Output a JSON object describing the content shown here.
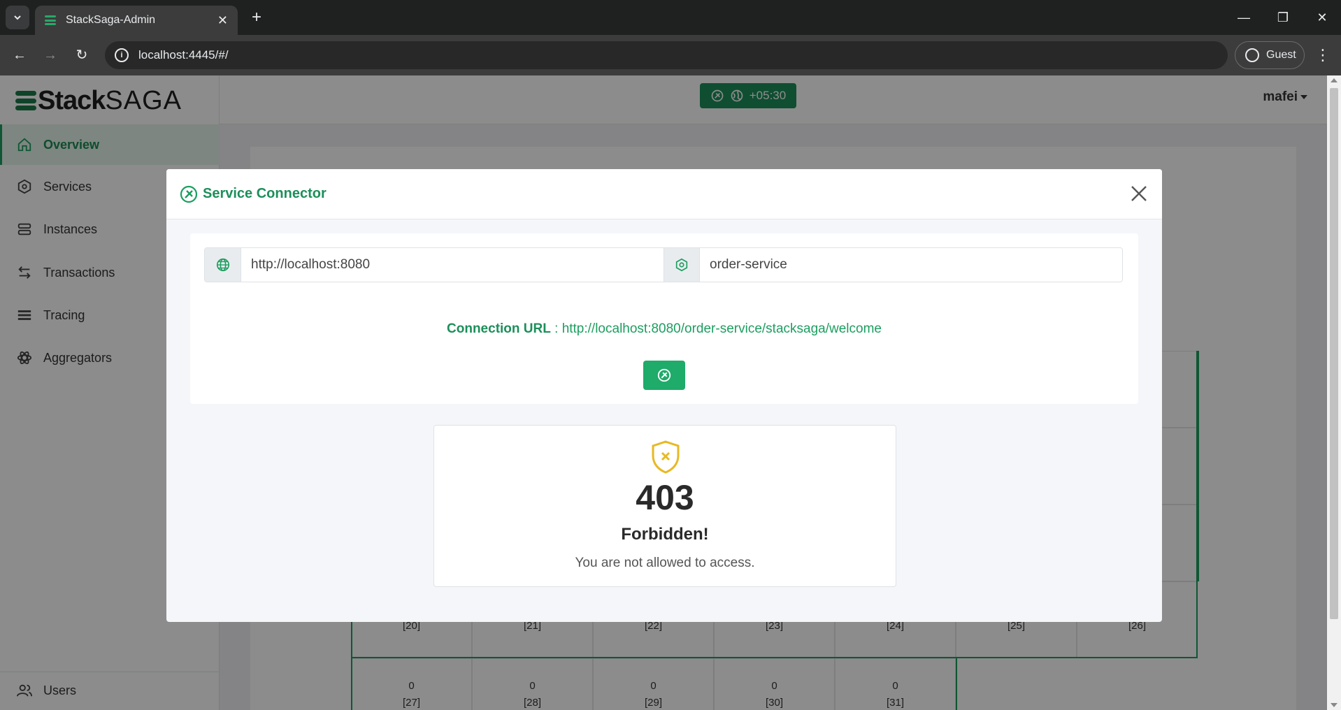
{
  "browser": {
    "tab_title": "StackSaga-Admin",
    "url": "localhost:4445/#/",
    "profile_label": "Guest"
  },
  "app": {
    "logo_stack": "Stack",
    "logo_saga": "SAGA",
    "timezone": "+05:30",
    "username": "mafei",
    "accent_color": "#1c9e5f"
  },
  "sidebar": {
    "items": [
      {
        "label": "Overview",
        "icon": "home-icon",
        "active": true
      },
      {
        "label": "Services",
        "icon": "hexagon-icon"
      },
      {
        "label": "Instances",
        "icon": "server-icon"
      },
      {
        "label": "Transactions",
        "icon": "arrows-icon"
      },
      {
        "label": "Tracing",
        "icon": "lines-icon"
      },
      {
        "label": "Aggregators",
        "icon": "atom-icon"
      }
    ],
    "bottom_item": {
      "label": "Users",
      "icon": "users-icon"
    }
  },
  "calendar": {
    "row_values": [
      "",
      "",
      "",
      "",
      "",
      "",
      ""
    ],
    "row4_days": [
      "[20]",
      "[21]",
      "[22]",
      "[23]",
      "[24]",
      "[25]",
      "[26]"
    ],
    "row5_values": [
      "0",
      "0",
      "0",
      "0",
      "0"
    ],
    "row5_days": [
      "[27]",
      "[28]",
      "[29]",
      "[30]",
      "[31]"
    ]
  },
  "modal": {
    "title": "Service Connector",
    "host_value": "http://localhost:8080",
    "service_value": "order-service",
    "connection_label": "Connection URL",
    "connection_separator": " : ",
    "connection_url": "http://localhost:8080/order-service/stacksaga/welcome",
    "error": {
      "code": "403",
      "title": "Forbidden!",
      "message": "You are not allowed to access."
    }
  }
}
